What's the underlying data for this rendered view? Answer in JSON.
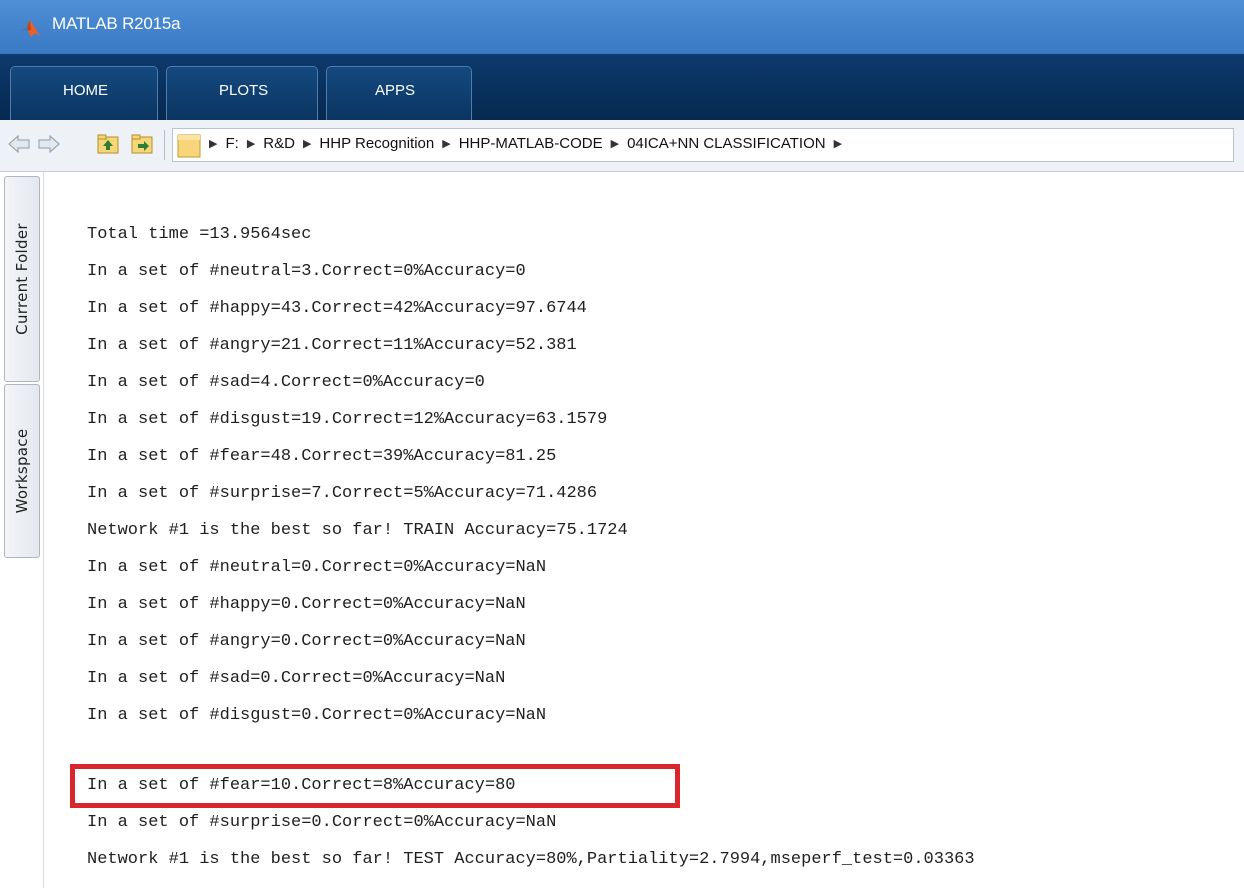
{
  "window": {
    "title": "MATLAB R2015a",
    "logo_icon": "matlab-logo-icon"
  },
  "tabs": [
    {
      "label": "HOME"
    },
    {
      "label": "PLOTS"
    },
    {
      "label": "APPS"
    }
  ],
  "toolbar": {
    "back_icon": "arrow-left-icon",
    "forward_icon": "arrow-right-icon",
    "up_icon": "folder-up-icon",
    "browse_icon": "browse-folder-icon",
    "folder_icon": "folder-icon",
    "path": [
      "F:",
      "R&D",
      "HHP Recognition",
      "HHP-MATLAB-CODE",
      "04ICA+NN CLASSIFICATION"
    ]
  },
  "side_tabs": {
    "current_folder": "Current Folder",
    "workspace": "Workspace"
  },
  "console": {
    "lines": [
      "Total time =13.9564sec",
      "In a set of #neutral=3.Correct=0%Accuracy=0",
      "In a set of #happy=43.Correct=42%Accuracy=97.6744",
      "In a set of #angry=21.Correct=11%Accuracy=52.381",
      "In a set of #sad=4.Correct=0%Accuracy=0",
      "In a set of #disgust=19.Correct=12%Accuracy=63.1579",
      "In a set of #fear=48.Correct=39%Accuracy=81.25",
      "In a set of #surprise=7.Correct=5%Accuracy=71.4286",
      "Network #1 is the best so far! TRAIN Accuracy=75.1724",
      "In a set of #neutral=0.Correct=0%Accuracy=NaN",
      "In a set of #happy=0.Correct=0%Accuracy=NaN",
      "In a set of #angry=0.Correct=0%Accuracy=NaN",
      "In a set of #sad=0.Correct=0%Accuracy=NaN",
      "In a set of #disgust=0.Correct=0%Accuracy=NaN",
      "In a set of #fear=10.Correct=8%Accuracy=80",
      "In a set of #surprise=0.Correct=0%Accuracy=NaN",
      "Network #1 is the best so far! TEST Accuracy=80%,Partiality=2.7994,mseperf_test=0.03363"
    ],
    "highlighted_line_index": 14,
    "highlight_color": "#d9262c"
  }
}
